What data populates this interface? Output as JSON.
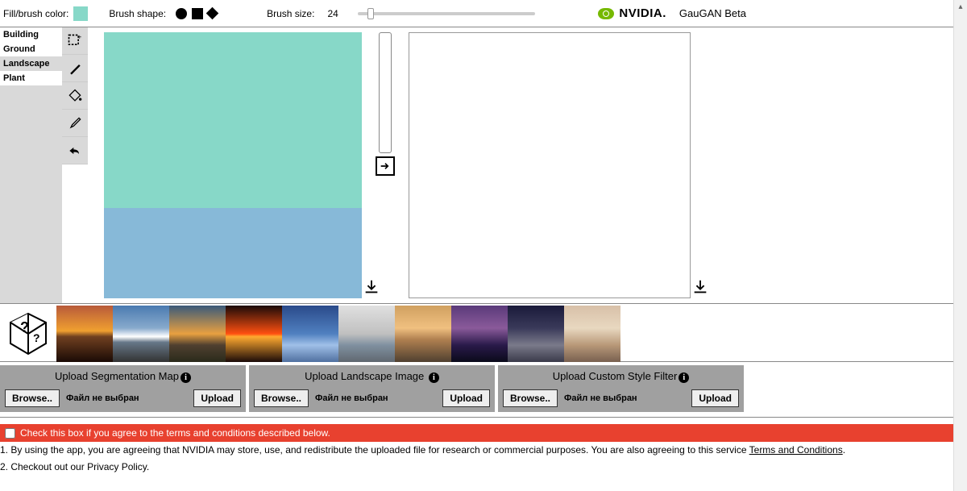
{
  "topbar": {
    "fill_label": "Fill/brush color:",
    "brush_color": "#87d8c8",
    "shape_label": "Brush shape:",
    "size_label": "Brush size:",
    "size_value": "24",
    "app_name": "GauGAN Beta",
    "brand": "NVIDIA."
  },
  "categories": {
    "items": [
      {
        "label": "Building",
        "selected": false
      },
      {
        "label": "Ground",
        "selected": false
      },
      {
        "label": "Landscape",
        "selected": true
      },
      {
        "label": "Plant",
        "selected": false
      }
    ]
  },
  "uploads": {
    "seg": {
      "title": "Upload Segmentation Map",
      "browse": "Browse..",
      "status": "Файл не выбран",
      "action": "Upload"
    },
    "land": {
      "title": "Upload Landscape Image ",
      "browse": "Browse..",
      "status": "Файл не выбран",
      "action": "Upload"
    },
    "style": {
      "title": "Upload Custom Style Filter",
      "browse": "Browse..",
      "status": "Файл не выбран",
      "action": "Upload"
    }
  },
  "terms": {
    "checkbox_text": "Check this box if you agree to the terms and conditions described below.",
    "line1a": "1. By using the app, you are agreeing that NVIDIA may store, use, and redistribute the uploaded file for research or commercial purposes. You are also agreeing to this service ",
    "line1b": "Terms and Conditions",
    "line1c": ".",
    "line2": "2. Checkout out our Privacy Policy."
  },
  "style_thumbs": [
    {
      "gradient": "linear-gradient(180deg,#b85a3a 0%,#f0a030 45%,#704020 55%,#1a0a05 100%)"
    },
    {
      "gradient": "linear-gradient(180deg,#4a7ab0 0%,#88aacc 40%,#ffffff 55%,#667788 65%,#333333 100%)"
    },
    {
      "gradient": "linear-gradient(180deg,#3a5a7a 0%,#e8a040 50%,#504030 70%,#2a2a1a 100%)"
    },
    {
      "gradient": "linear-gradient(180deg,#1a0a08 0%,#ff5010 50%,#ffaa30 55%,#1a0a08 100%)"
    },
    {
      "gradient": "linear-gradient(180deg,#2a4a8a 0%,#5080c0 50%,#a0c0e8 70%,#5070a0 100%)"
    },
    {
      "gradient": "linear-gradient(180deg,#e0e0e0 0%,#c0c0c0 50%,#8090a0 70%,#606870 100%)"
    },
    {
      "gradient": "linear-gradient(180deg,#d0a060 0%,#f0c080 40%,#b08050 60%,#504030 100%)"
    },
    {
      "gradient": "linear-gradient(180deg,#5a3a7a 0%,#8a5a9a 40%,#2a1a4a 70%,#0a0a1a 100%)"
    },
    {
      "gradient": "linear-gradient(180deg,#1a1a3a 0%,#3a3a5a 40%,#7a7a8a 70%,#3a3a4a 100%)"
    },
    {
      "gradient": "linear-gradient(180deg,#d8c0a8 0%,#e8d8c0 40%,#b89878 70%,#786050 100%)"
    }
  ]
}
